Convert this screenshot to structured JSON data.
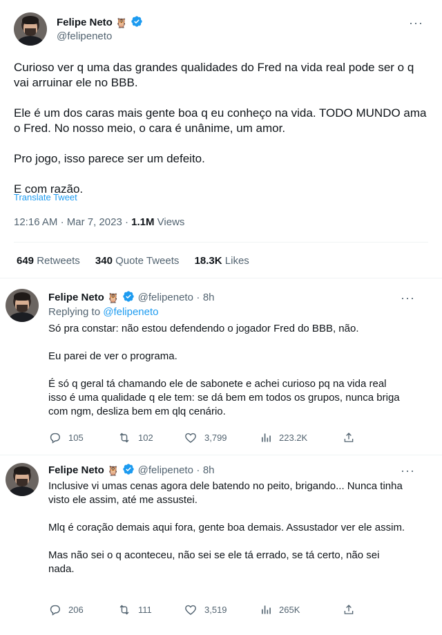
{
  "main_tweet": {
    "author_name": "Felipe Neto",
    "author_emoji": "🦉",
    "handle": "@felipeneto",
    "more": "···",
    "paragraphs": [
      "Curioso ver q uma das grandes qualidades do Fred na vida real pode ser o q vai arruinar ele no BBB.",
      "Ele é um dos caras mais gente boa q eu conheço na vida. TODO MUNDO ama o Fred. No nosso meio, o cara é unânime, um amor.",
      "Pro jogo, isso parece ser um defeito.",
      "E com razão."
    ],
    "translate_label": "Translate Tweet",
    "time": "12:16 AM",
    "separator": "·",
    "date": "Mar 7, 2023",
    "views_count": "1.1M",
    "views_label": "Views",
    "retweets_count": "649",
    "retweets_label": "Retweets",
    "quotes_count": "340",
    "quotes_label": "Quote Tweets",
    "likes_count": "18.3K",
    "likes_label": "Likes"
  },
  "replies": [
    {
      "author_name": "Felipe Neto",
      "author_emoji": "🦉",
      "handle": "@felipeneto",
      "separator": "·",
      "age": "8h",
      "replying_prefix": "Replying to",
      "replying_to": "@felipeneto",
      "paragraphs": [
        "Só pra constar: não estou defendendo o jogador Fred do BBB, não.",
        "Eu parei de ver o programa.",
        "É só q geral tá chamando ele de sabonete e achei curioso pq na vida real isso é uma qualidade q ele tem: se dá bem em todos os grupos, nunca briga com ngm, desliza bem em qlq cenário."
      ],
      "replies": "105",
      "retweets": "102",
      "likes": "3,799",
      "views": "223.2K"
    },
    {
      "author_name": "Felipe Neto",
      "author_emoji": "🦉",
      "handle": "@felipeneto",
      "separator": "·",
      "age": "8h",
      "paragraphs": [
        "Inclusive vi umas cenas agora dele batendo no peito, brigando... Nunca tinha visto ele assim, até me assustei.",
        "Mlq é coração demais aqui fora, gente boa demais. Assustador ver ele assim.",
        "Mas não sei o q aconteceu, não sei se ele tá errado, se tá certo, não sei nada."
      ],
      "replies": "206",
      "retweets": "111",
      "likes": "3,519",
      "views": "265K"
    }
  ],
  "colors": {
    "accent": "#1d9bf0",
    "text": "#0f1419",
    "muted": "#536471",
    "divider": "#eff3f4"
  }
}
